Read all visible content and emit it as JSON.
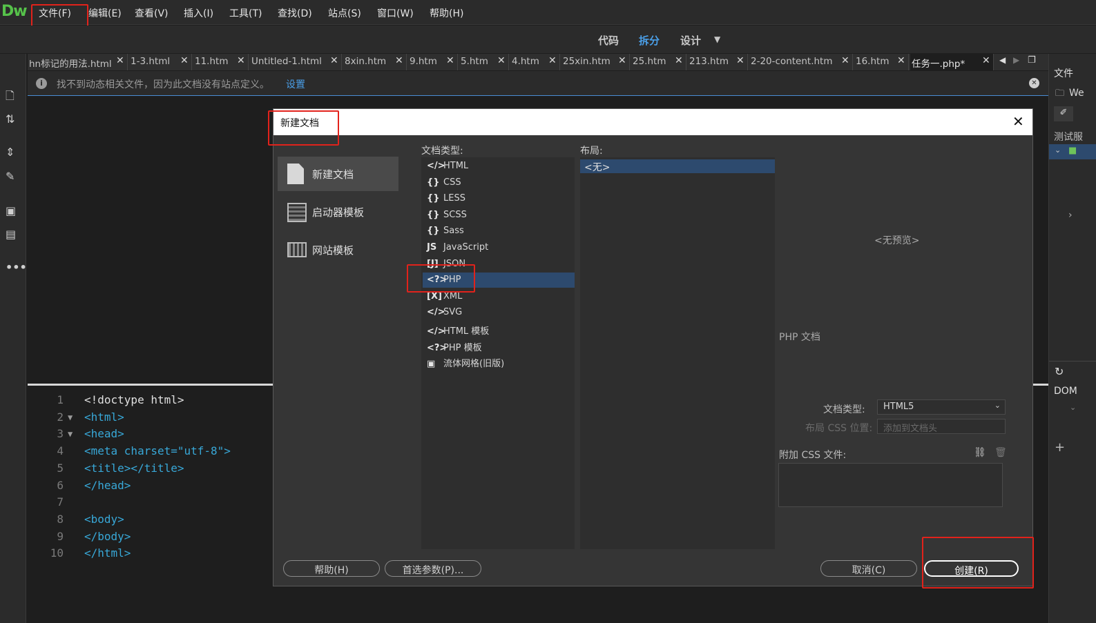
{
  "app": {
    "logo": "Dw"
  },
  "menu": [
    "文件(F)",
    "编辑(E)",
    "查看(V)",
    "插入(I)",
    "工具(T)",
    "查找(D)",
    "站点(S)",
    "窗口(W)",
    "帮助(H)"
  ],
  "view_buttons": {
    "code": "代码",
    "split": "拆分",
    "design": "设计"
  },
  "tabs": [
    "hn标记的用法.html",
    "1-3.html",
    "11.htm",
    "Untitled-1.html",
    "8xin.htm",
    "9.htm",
    "5.htm",
    "4.htm",
    "25xin.htm",
    "25.htm",
    "213.htm",
    "2-20-content.htm",
    "16.htm",
    "任务一.php*"
  ],
  "infobar": {
    "message": "找不到动态相关文件，因为此文档没有站点定义。",
    "link": "设置"
  },
  "code_lines": [
    {
      "n": "1",
      "text": "<!doctype html>"
    },
    {
      "n": "2",
      "text": "<html>"
    },
    {
      "n": "3",
      "text": "<head>"
    },
    {
      "n": "4",
      "text": "<meta charset=\"utf-8\">"
    },
    {
      "n": "5",
      "text": "<title></title>"
    },
    {
      "n": "6",
      "text": "</head>"
    },
    {
      "n": "7",
      "text": ""
    },
    {
      "n": "8",
      "text": "<body>"
    },
    {
      "n": "9",
      "text": "</body>"
    },
    {
      "n": "10",
      "text": "</html>"
    }
  ],
  "right_panel": {
    "files": "文件",
    "site": "We",
    "test": "测试服",
    "dom": "DOM"
  },
  "dialog": {
    "title": "新建文档",
    "categories": [
      "新建文档",
      "启动器模板",
      "网站模板"
    ],
    "doc_type_label": "文档类型:",
    "layout_label": "布局:",
    "doc_types": [
      {
        "icon": "</>",
        "label": "HTML"
      },
      {
        "icon": "{}",
        "label": "CSS"
      },
      {
        "icon": "{}",
        "label": "LESS"
      },
      {
        "icon": "{}",
        "label": "SCSS"
      },
      {
        "icon": "{}",
        "label": "Sass"
      },
      {
        "icon": "JS",
        "label": "JavaScript"
      },
      {
        "icon": "[J]",
        "label": "JSON"
      },
      {
        "icon": "<?>",
        "label": "PHP"
      },
      {
        "icon": "[X]",
        "label": "XML"
      },
      {
        "icon": "</>",
        "label": "SVG"
      },
      {
        "icon": "</>",
        "label": "HTML 模板"
      },
      {
        "icon": "<?>",
        "label": "PHP 模板"
      },
      {
        "icon": "▣",
        "label": "流体网格(旧版)"
      }
    ],
    "layouts": [
      "<无>"
    ],
    "preview": "<无预览>",
    "description": "PHP 文档",
    "doctype_field_label": "文档类型:",
    "doctype_field_value": "HTML5",
    "layout_css_label": "布局 CSS 位置:",
    "layout_css_value": "添加到文档头",
    "attach_css_label": "附加 CSS 文件:",
    "buttons": {
      "help": "帮助(H)",
      "prefs": "首选参数(P)...",
      "cancel": "取消(C)",
      "create": "创建(R)"
    }
  },
  "colors": {
    "accent": "#4a8ed6",
    "selection": "#2d4a6e",
    "highlight": "#e2221b",
    "logo": "#56c24a"
  }
}
